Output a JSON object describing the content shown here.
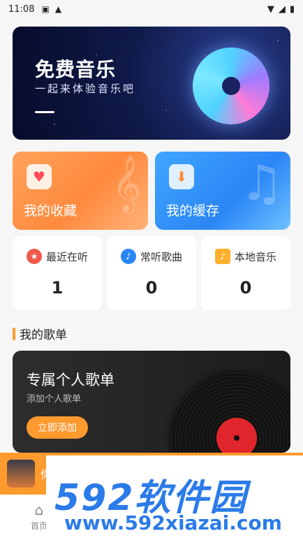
{
  "status_bar": {
    "time": "11:08"
  },
  "banner": {
    "title": "免费音乐",
    "subtitle": "一起来体验音乐吧"
  },
  "cards": {
    "favorites": {
      "label": "我的收藏",
      "icon": "heart-icon"
    },
    "cache": {
      "label": "我的缓存",
      "icon": "download-icon"
    }
  },
  "stats": [
    {
      "label": "最近在听",
      "value": "1",
      "icon": "star-icon",
      "color": "#f05a4b"
    },
    {
      "label": "常听歌曲",
      "value": "0",
      "icon": "music-note-icon",
      "color": "#2b86f5"
    },
    {
      "label": "本地音乐",
      "value": "0",
      "icon": "folder-music-icon",
      "color": "#ffb02e"
    }
  ],
  "section": {
    "title": "我的歌单"
  },
  "playlist": {
    "title": "专属个人歌单",
    "subtitle": "添加个人歌单",
    "button": "立即添加"
  },
  "mini_player": {
    "title": "你"
  },
  "bottom_nav": {
    "home": "首页"
  },
  "watermark": {
    "big": "592软件园",
    "small": "www.592xiazai.com"
  },
  "colors": {
    "accent": "#ff9a2e",
    "blue": "#2b86f5"
  }
}
